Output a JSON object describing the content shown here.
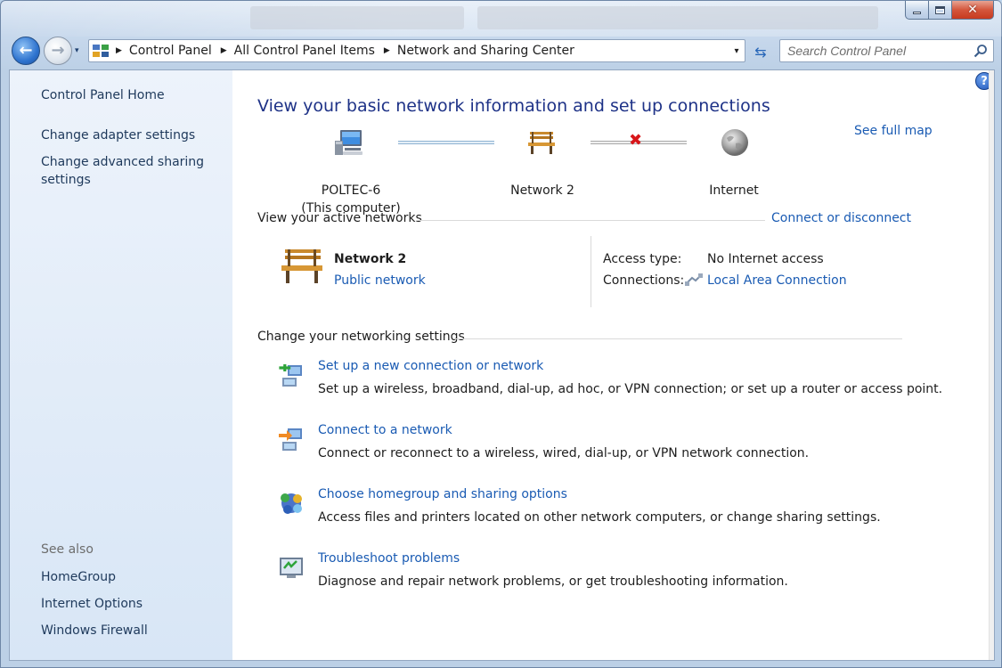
{
  "window": {
    "close_glyph": "✕"
  },
  "nav": {
    "back_glyph": "←",
    "forward_glyph": "→",
    "recent_glyph": "▾",
    "breadcrumbs": [
      "Control Panel",
      "All Control Panel Items",
      "Network and Sharing Center"
    ],
    "address_dropdown_glyph": "▾",
    "refresh_glyph": "⇆",
    "search_placeholder": "Search Control Panel"
  },
  "sidebar": {
    "home": "Control Panel Home",
    "links": [
      "Change adapter settings",
      "Change advanced sharing settings"
    ],
    "see_also_heading": "See also",
    "see_also": [
      "HomeGroup",
      "Internet Options",
      "Windows Firewall"
    ]
  },
  "main": {
    "help_glyph": "?",
    "title": "View your basic network information and set up connections",
    "see_full_map": "See full map",
    "map": {
      "computer_name": "POLTEC-6",
      "computer_sub": "(This computer)",
      "network": "Network  2",
      "internet": "Internet",
      "broken_glyph": "✖"
    },
    "active_networks_heading": "View your active networks",
    "connect_or_disconnect": "Connect or disconnect",
    "active_network": {
      "name": "Network  2",
      "type": "Public network",
      "access_type_label": "Access type:",
      "access_type_value": "No Internet access",
      "connections_label": "Connections:",
      "connections_value": "Local Area Connection"
    },
    "settings_heading": "Change your networking settings",
    "tasks": [
      {
        "icon": "new-connection-icon",
        "title": "Set up a new connection or network",
        "desc": "Set up a wireless, broadband, dial-up, ad hoc, or VPN connection; or set up a router or access point."
      },
      {
        "icon": "connect-network-icon",
        "title": "Connect to a network",
        "desc": "Connect or reconnect to a wireless, wired, dial-up, or VPN network connection."
      },
      {
        "icon": "homegroup-icon",
        "title": "Choose homegroup and sharing options",
        "desc": "Access files and printers located on other network computers, or change sharing settings."
      },
      {
        "icon": "troubleshoot-icon",
        "title": "Troubleshoot problems",
        "desc": "Diagnose and repair network problems, or get troubleshooting information."
      }
    ]
  },
  "colors": {
    "link": "#1a5bb3",
    "title": "#1e3287",
    "sidebar_link": "#1e395b",
    "broken": "#d8161a"
  }
}
